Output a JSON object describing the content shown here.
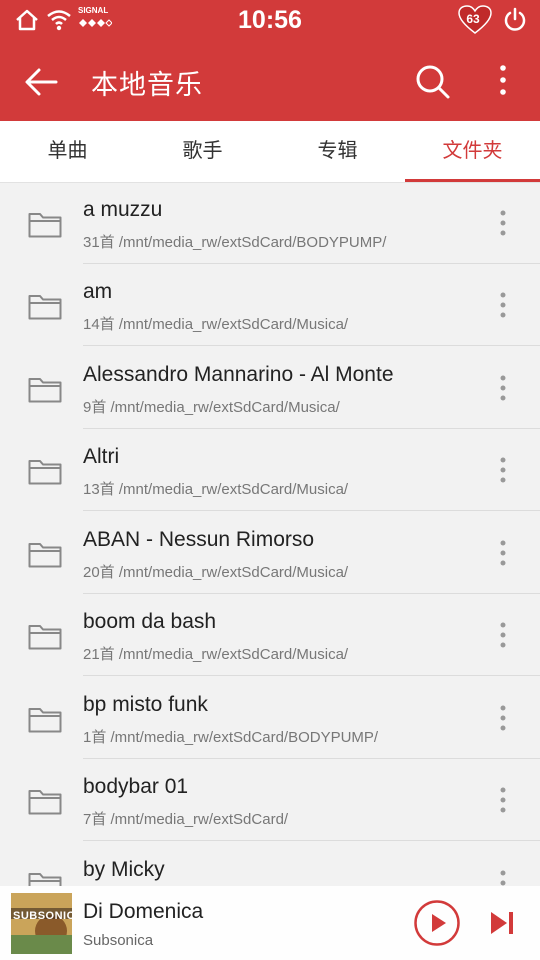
{
  "status_bar": {
    "time": "10:56",
    "signal_text": "SIGNAL",
    "battery": "63"
  },
  "app_bar": {
    "title": "本地音乐",
    "back_icon": "arrow-left-icon",
    "search_icon": "search-icon",
    "more_icon": "more-vertical-icon"
  },
  "tabs": [
    {
      "label": "单曲",
      "active": false
    },
    {
      "label": "歌手",
      "active": false
    },
    {
      "label": "专辑",
      "active": false
    },
    {
      "label": "文件夹",
      "active": true
    }
  ],
  "folders": [
    {
      "name": "a muzzu",
      "detail": "31首 /mnt/media_rw/extSdCard/BODYPUMP/"
    },
    {
      "name": "am",
      "detail": "14首 /mnt/media_rw/extSdCard/Musica/"
    },
    {
      "name": "Alessandro Mannarino - Al Monte",
      "detail": "9首 /mnt/media_rw/extSdCard/Musica/"
    },
    {
      "name": "Altri",
      "detail": "13首 /mnt/media_rw/extSdCard/Musica/"
    },
    {
      "name": "ABAN - Nessun Rimorso",
      "detail": "20首 /mnt/media_rw/extSdCard/Musica/"
    },
    {
      "name": "boom da bash",
      "detail": "21首 /mnt/media_rw/extSdCard/Musica/"
    },
    {
      "name": "bp misto funk",
      "detail": "1首 /mnt/media_rw/extSdCard/BODYPUMP/"
    },
    {
      "name": "bodybar 01",
      "detail": "7首 /mnt/media_rw/extSdCard/"
    },
    {
      "name": "by Micky",
      "detail": ""
    }
  ],
  "now_playing": {
    "title": "Di Domenica",
    "artist": "Subsonica",
    "album_art_text": "SUBSONICA"
  },
  "colors": {
    "accent": "#d23a3a",
    "background": "#f2f2f2"
  }
}
